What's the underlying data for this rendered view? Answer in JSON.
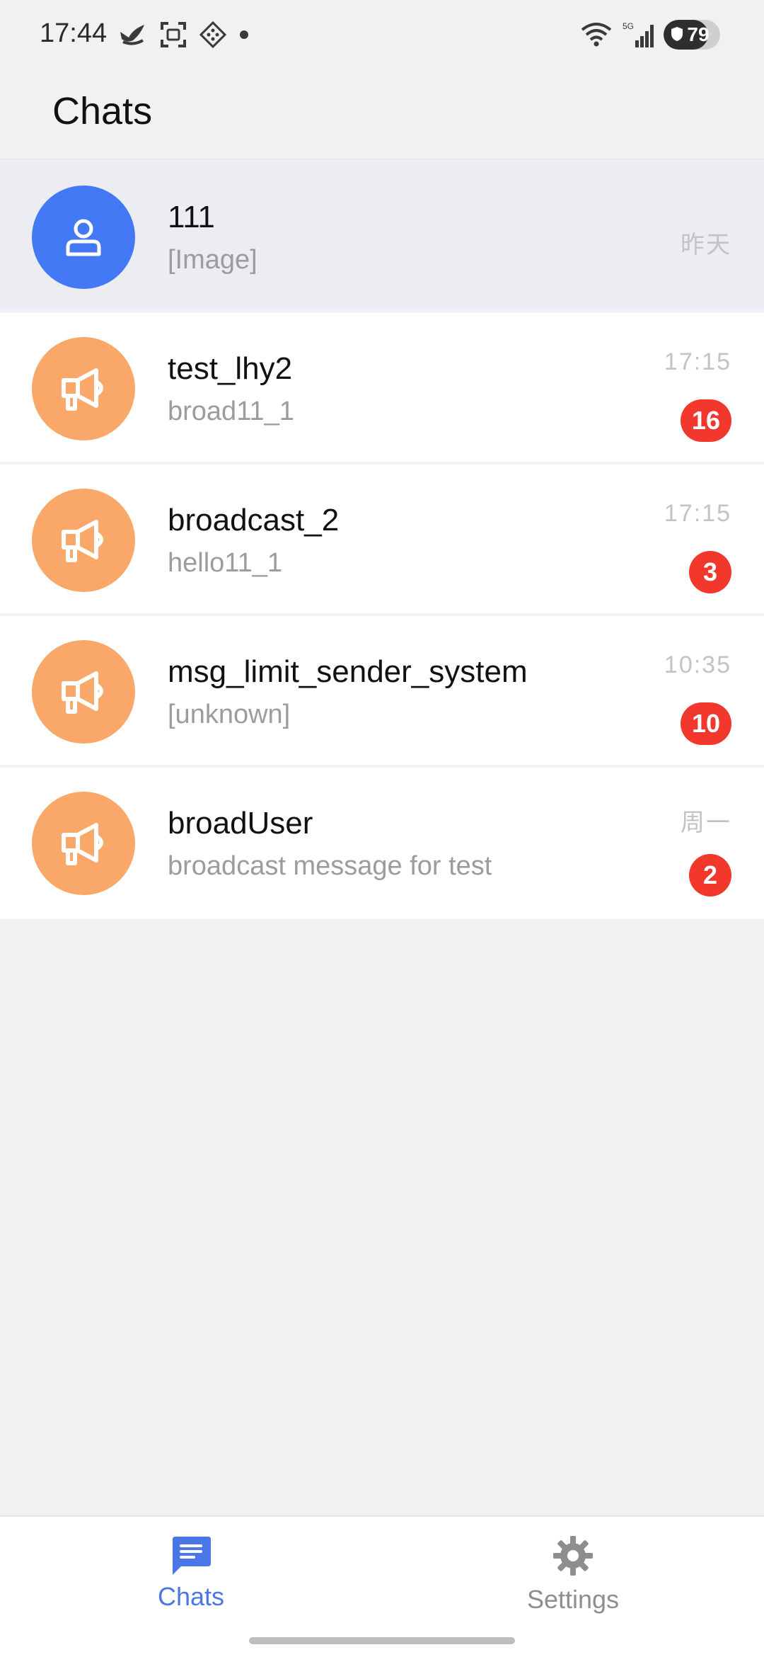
{
  "status_bar": {
    "time": "17:44",
    "left_icons": [
      "bird-notification-icon",
      "screenshot-icon",
      "pattern-icon",
      "dot-icon"
    ],
    "network": "5G",
    "battery_level": "79"
  },
  "header": {
    "title": "Chats"
  },
  "chats": [
    {
      "name": "111",
      "preview": "[Image]",
      "time": "昨天",
      "unread": "",
      "avatar": "user-icon",
      "pinned": true
    },
    {
      "name": "test_lhy2",
      "preview": "broad11_1",
      "time": "17:15",
      "unread": "16",
      "avatar": "megaphone-icon"
    },
    {
      "name": "broadcast_2",
      "preview": "hello11_1",
      "time": "17:15",
      "unread": "3",
      "avatar": "megaphone-icon"
    },
    {
      "name": "msg_limit_sender_system",
      "preview": "[unknown]",
      "time": "10:35",
      "unread": "10",
      "avatar": "megaphone-icon"
    },
    {
      "name": "broadUser",
      "preview": "broadcast message for test",
      "time": "周一",
      "unread": "2",
      "avatar": "megaphone-icon"
    }
  ],
  "bottom_nav": {
    "chats_label": "Chats",
    "settings_label": "Settings",
    "active": "chats"
  },
  "colors": {
    "accent": "#4a76e8",
    "user_avatar": "#4479f6",
    "broadcast_avatar": "#f9a869",
    "badge": "#f2372c"
  }
}
